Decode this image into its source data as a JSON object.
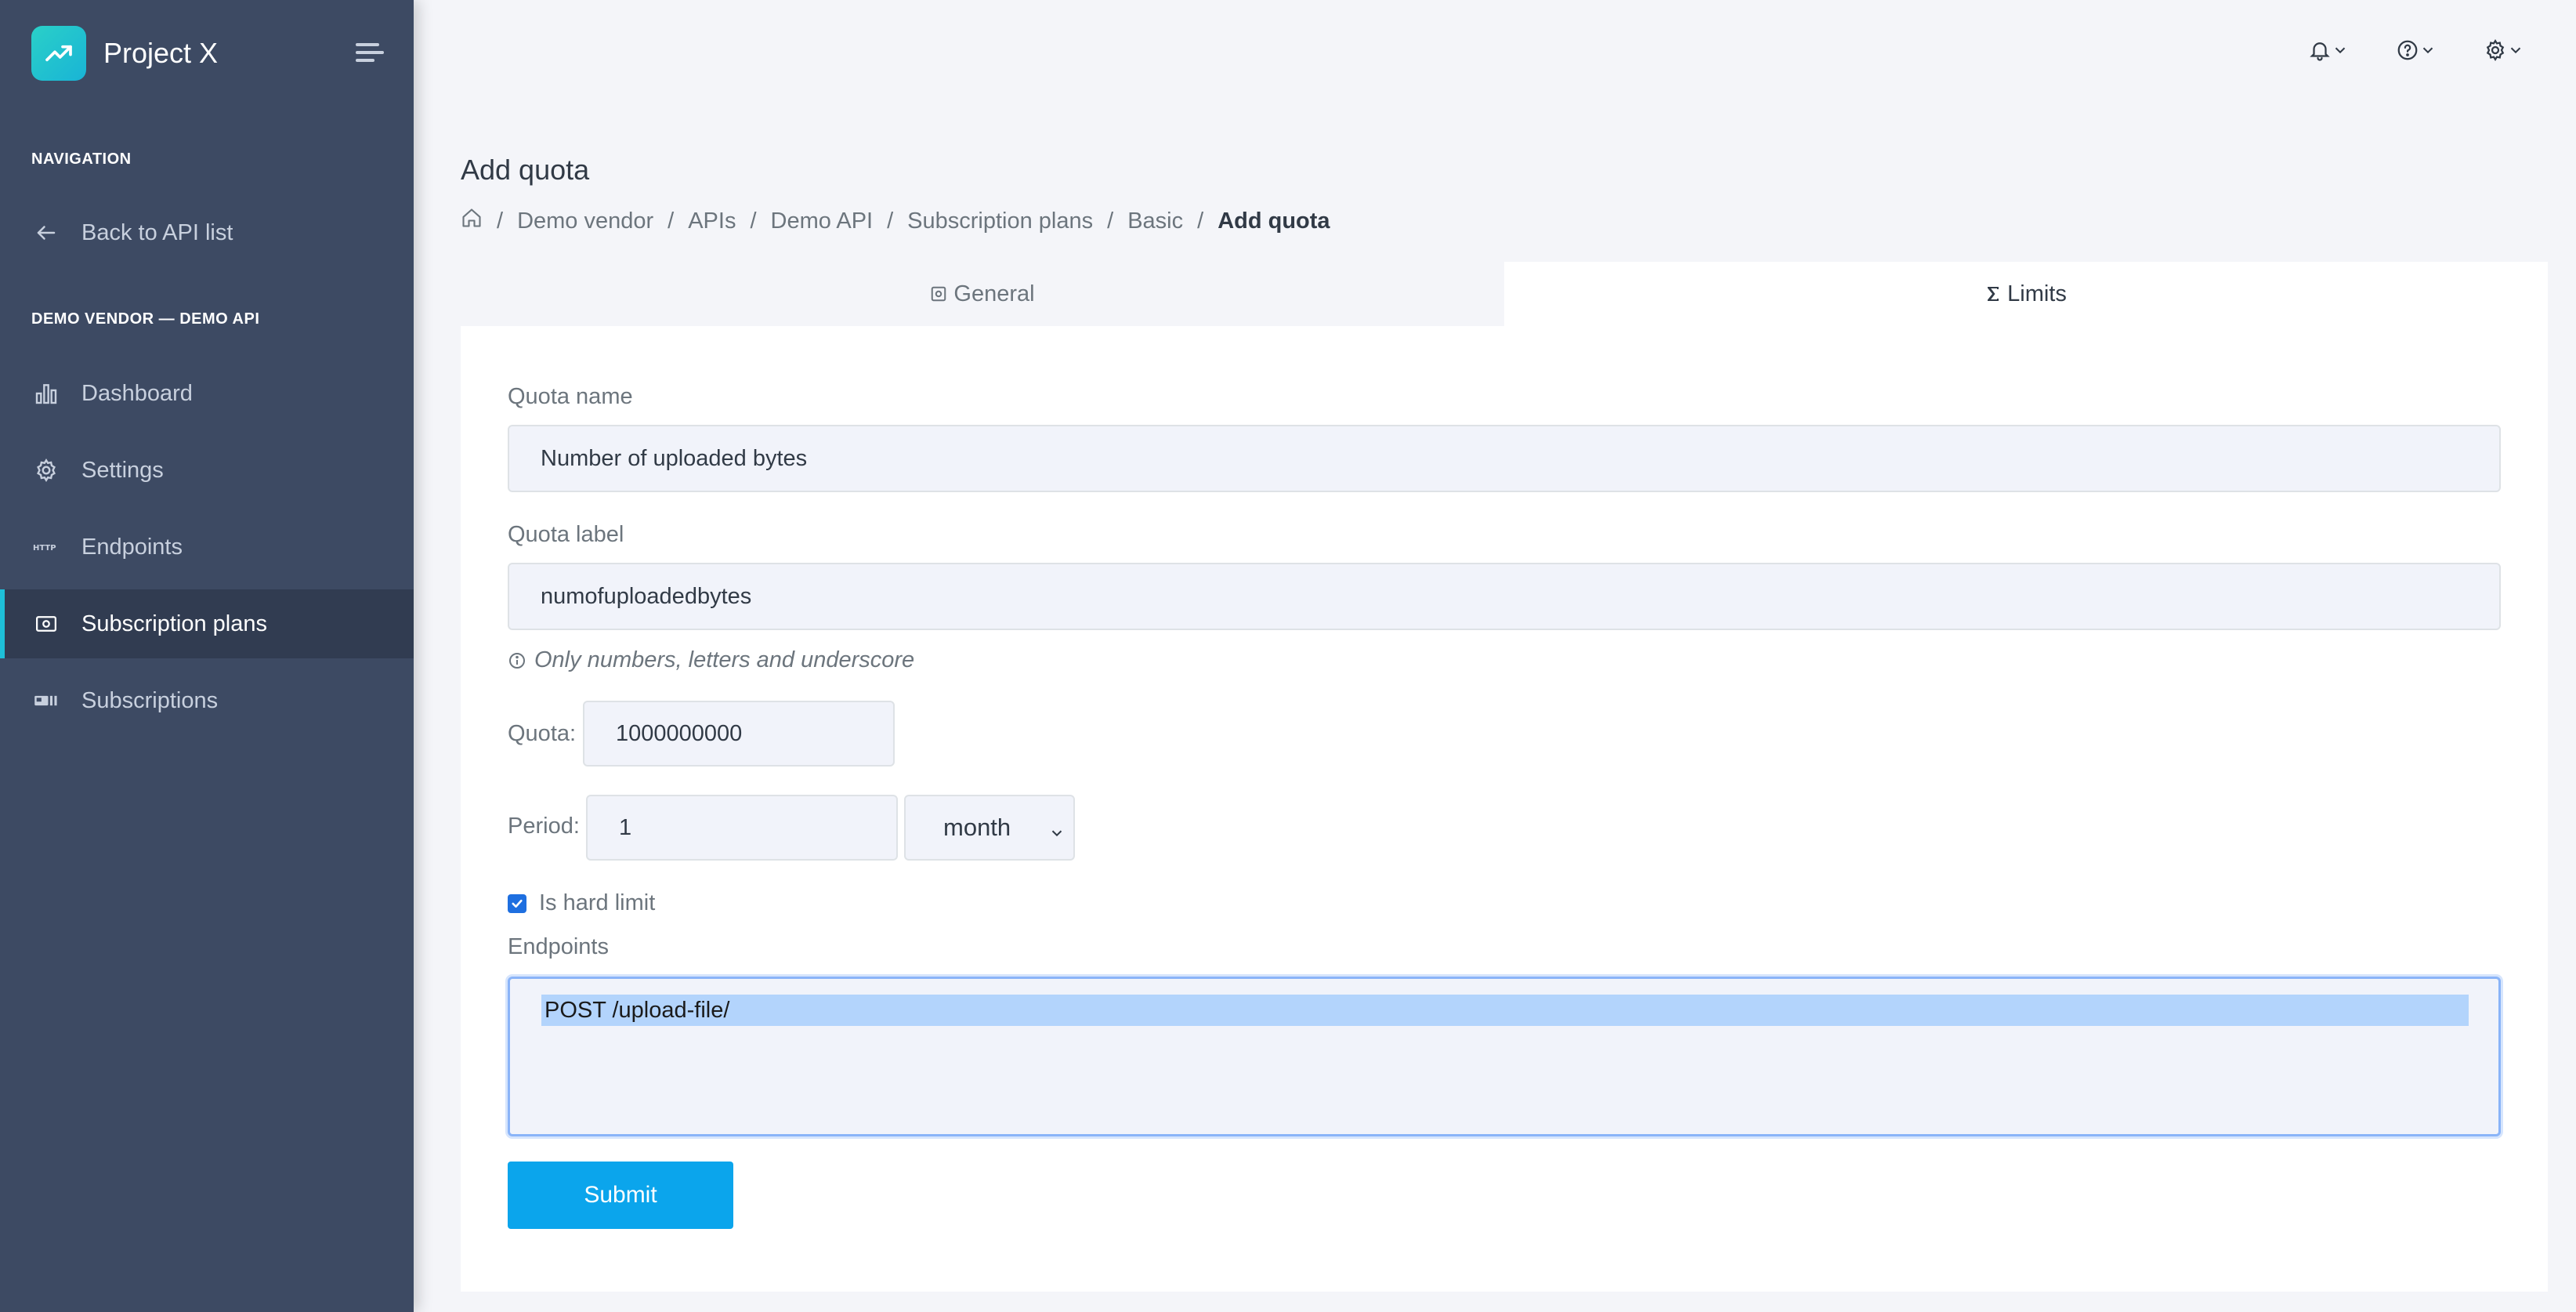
{
  "app": {
    "name": "Project X"
  },
  "sidebar": {
    "navigation_heading": "NAVIGATION",
    "back_label": "Back to API list",
    "section_heading": "DEMO VENDOR — DEMO API",
    "items": [
      {
        "label": "Dashboard",
        "icon": "bar-chart-icon"
      },
      {
        "label": "Settings",
        "icon": "gear-icon"
      },
      {
        "label": "Endpoints",
        "icon": "http-icon"
      },
      {
        "label": "Subscription plans",
        "icon": "dollar-card-icon",
        "active": true
      },
      {
        "label": "Subscriptions",
        "icon": "id-card-icon"
      }
    ]
  },
  "topbar": {
    "icons": [
      "bell-icon",
      "help-icon",
      "gear-icon"
    ]
  },
  "page": {
    "title": "Add quota",
    "breadcrumb": [
      "Demo vendor",
      "APIs",
      "Demo API",
      "Subscription plans",
      "Basic"
    ],
    "breadcrumb_current": "Add quota"
  },
  "tabs": [
    {
      "label": "General",
      "active": false
    },
    {
      "label": "Limits",
      "active": true
    }
  ],
  "form": {
    "quota_name_label": "Quota name",
    "quota_name_value": "Number of uploaded bytes",
    "quota_label_label": "Quota label",
    "quota_label_value": "numofuploadedbytes",
    "quota_label_help": "Only numbers, letters and underscore",
    "quota_field_label": "Quota:",
    "quota_value": "1000000000",
    "period_label": "Period:",
    "period_value": "1",
    "period_unit": "month",
    "hard_limit_label": "Is hard limit",
    "hard_limit_checked": true,
    "endpoints_label": "Endpoints",
    "endpoints_options": [
      "POST /upload-file/"
    ],
    "submit_label": "Submit"
  },
  "colors": {
    "sidebar_bg": "#3d4a63",
    "accent": "#1ec0d8",
    "primary_button": "#0ba5ec"
  }
}
